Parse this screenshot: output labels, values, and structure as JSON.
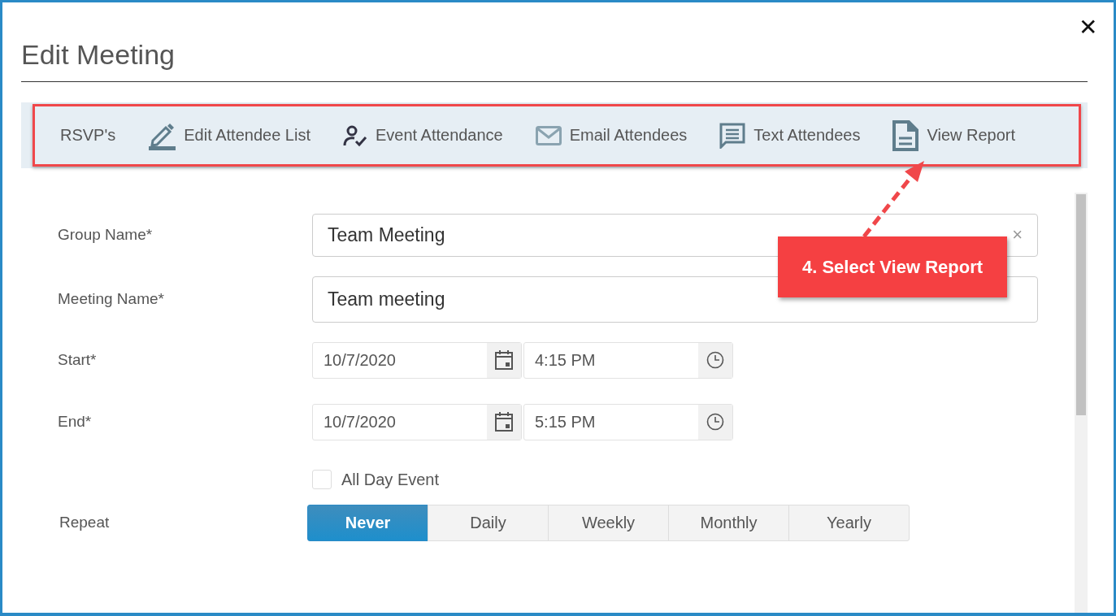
{
  "dialog": {
    "title": "Edit Meeting",
    "close": "✕"
  },
  "toolbar": [
    {
      "label": "RSVP's",
      "kind": "text"
    },
    {
      "label": "Edit Attendee List",
      "kind": "pencil"
    },
    {
      "label": "Event Attendance",
      "kind": "person-check"
    },
    {
      "label": "Email Attendees",
      "kind": "envelope"
    },
    {
      "label": "Text Attendees",
      "kind": "chat"
    },
    {
      "label": "View Report",
      "kind": "document"
    }
  ],
  "form": {
    "group_name": {
      "label": "Group Name*",
      "value": "Team Meeting",
      "clear": "×"
    },
    "meeting_name": {
      "label": "Meeting Name*",
      "value": "Team meeting"
    },
    "start": {
      "label": "Start*",
      "date": "10/7/2020",
      "time": "4:15 PM"
    },
    "end": {
      "label": "End*",
      "date": "10/7/2020",
      "time": "5:15 PM"
    },
    "all_day": {
      "label": "All Day Event",
      "checked": false
    },
    "repeat": {
      "label": "Repeat",
      "options": [
        {
          "label": "Never",
          "selected": true
        },
        {
          "label": "Daily",
          "selected": false
        },
        {
          "label": "Weekly",
          "selected": false
        },
        {
          "label": "Monthly",
          "selected": false
        },
        {
          "label": "Yearly",
          "selected": false
        }
      ]
    }
  },
  "annotation": {
    "text": "4. Select View Report"
  }
}
